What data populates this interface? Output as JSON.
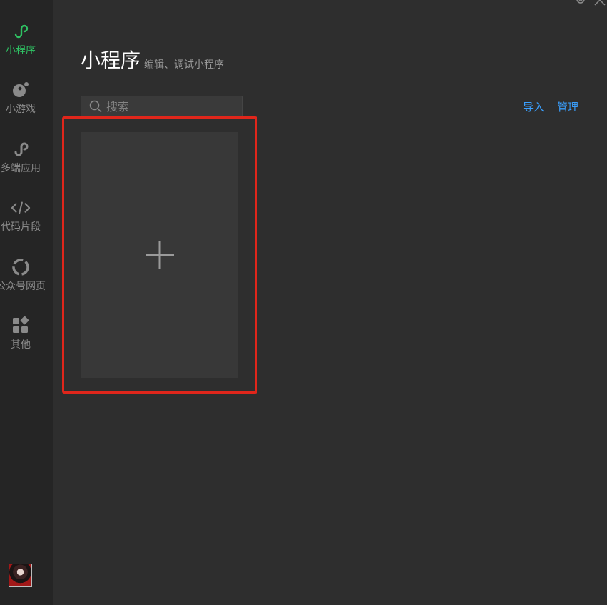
{
  "sidebar": {
    "items": [
      {
        "label": "小程序",
        "icon": "miniprogram-icon",
        "active": true
      },
      {
        "label": "小游戏",
        "icon": "minigame-icon",
        "active": false
      },
      {
        "label": "多端应用",
        "icon": "multiplatform-icon",
        "active": false
      },
      {
        "label": "代码片段",
        "icon": "code-snippet-icon",
        "active": false
      },
      {
        "label": "公众号网页",
        "icon": "official-account-icon",
        "active": false
      },
      {
        "label": "其他",
        "icon": "apps-icon",
        "active": false
      }
    ],
    "avatar": "user-avatar"
  },
  "header": {
    "title": "小程序",
    "subtitle": "编辑、调试小程序"
  },
  "search": {
    "placeholder": "搜索",
    "value": ""
  },
  "actions": {
    "import_label": "导入",
    "manage_label": "管理"
  },
  "new_project": {
    "icon": "plus-icon"
  },
  "colors": {
    "accent": "#2fc163",
    "link": "#3aa0ff",
    "highlight": "#e0261b",
    "background": "#2e2e2e",
    "sidebar": "#252525"
  }
}
